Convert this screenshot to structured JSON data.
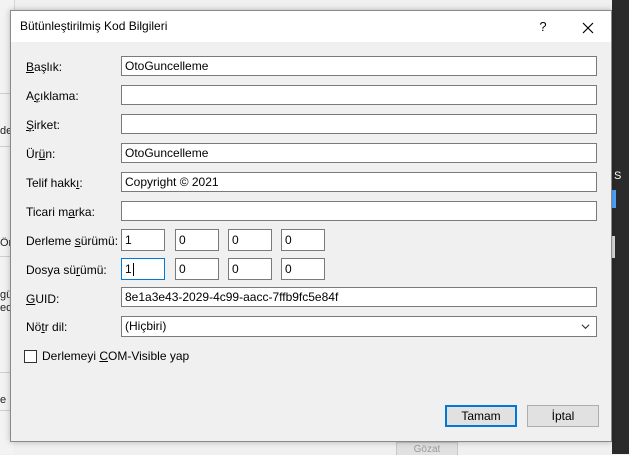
{
  "dialog": {
    "title": "Bütünleştirilmiş Kod Bilgileri",
    "help_glyph": "?",
    "close_glyph": "✕"
  },
  "form": {
    "title": {
      "label_u": "B",
      "label_rest": "aşlık:",
      "value": "OtoGuncelleme"
    },
    "description": {
      "label_pre": "A",
      "label_u": "ç",
      "label_rest": "ıklama:",
      "value": ""
    },
    "company": {
      "label_u": "Ş",
      "label_rest": "irket:",
      "value": ""
    },
    "product": {
      "label_pre": "Ür",
      "label_u": "ü",
      "label_rest": "n:",
      "value": "OtoGuncelleme"
    },
    "copyright": {
      "label_pre": "Telif hakk",
      "label_u": "ı",
      "label_rest": ":",
      "value": "Copyright ©  2021"
    },
    "trademark": {
      "label_pre": "Ticari m",
      "label_u": "a",
      "label_rest": "rka:",
      "value": ""
    },
    "assembly_version": {
      "label_pre": "Derleme ",
      "label_u": "s",
      "label_rest": "ürümü:",
      "values": [
        "1",
        "0",
        "0",
        "0"
      ]
    },
    "file_version": {
      "label_pre": "Dosya sü",
      "label_u": "r",
      "label_rest": "ümü:",
      "values": [
        "1",
        "0",
        "0",
        "0"
      ]
    },
    "guid": {
      "label_u": "G",
      "label_rest": "UID:",
      "value": "8e1a3e43-2029-4c99-aacc-7ffb9fc5e84f"
    },
    "neutral_language": {
      "label_pre": "Nö",
      "label_u": "t",
      "label_rest": "r dil:",
      "value": "(Hiçbiri)"
    },
    "com_visible": {
      "label_pre": "Derlemeyi ",
      "label_u": "C",
      "label_rest": "OM-Visible yap",
      "checked": false
    }
  },
  "buttons": {
    "ok": "Tamam",
    "cancel": "İptal"
  },
  "background": {
    "left_fragments": [
      "de",
      "Ör",
      "gü",
      "ed",
      "e"
    ],
    "right_fragment": "S",
    "bottom_button": "Gözat"
  }
}
